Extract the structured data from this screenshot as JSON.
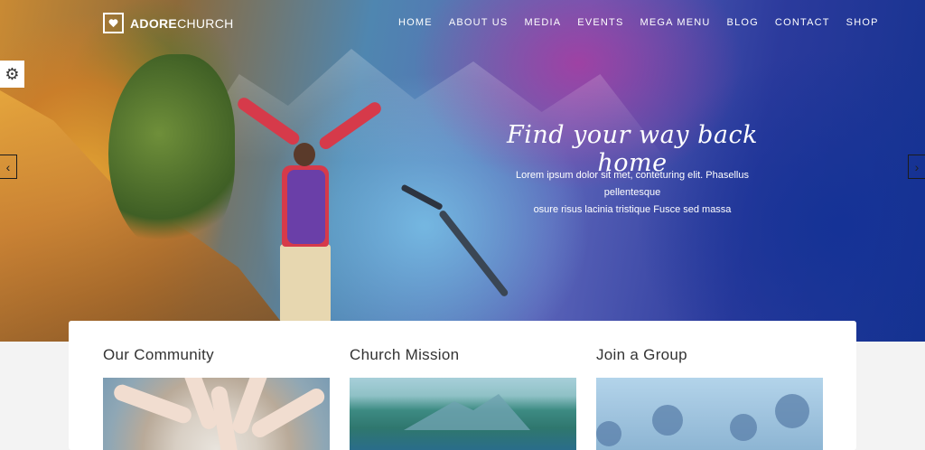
{
  "brand": {
    "name_bold": "ADORE",
    "name_rest": "CHURCH"
  },
  "nav": {
    "items": [
      "HOME",
      "ABOUT US",
      "MEDIA",
      "EVENTS",
      "MEGA MENU",
      "BLOG",
      "CONTACT",
      "SHOP"
    ]
  },
  "hero": {
    "title": "Find your way back home",
    "subtitle_line1": "Lorem ipsum dolor sit met, conteturing elit. Phasellus pellentesque",
    "subtitle_line2": "osure risus lacinia tristique Fusce sed massa"
  },
  "cards": [
    {
      "title": "Our Community"
    },
    {
      "title": "Church Mission"
    },
    {
      "title": "Join a Group"
    }
  ],
  "icons": {
    "settings": "gear-icon",
    "prev": "chevron-left-icon",
    "next": "chevron-right-icon",
    "logo": "heart-icon"
  },
  "colors": {
    "accent": "#ffffff",
    "dark_blue": "#14328f"
  }
}
